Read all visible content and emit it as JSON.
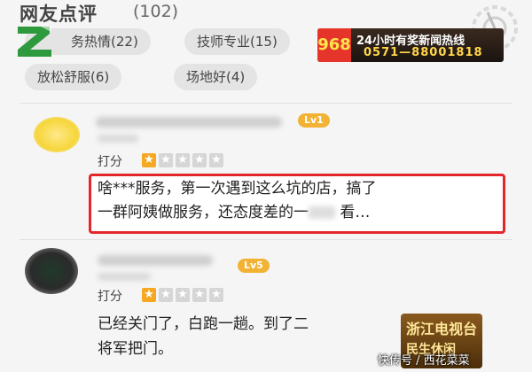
{
  "header": {
    "title": "网友点评",
    "count": "(102)"
  },
  "tags": [
    {
      "label": "务热情(22)"
    },
    {
      "label": "技师专业(15)"
    },
    {
      "label": "放松舒服(6)"
    },
    {
      "label": "场地好(4)"
    }
  ],
  "reviews": [
    {
      "level": "Lv1",
      "score_label": "打分",
      "rating": 1,
      "max_rating": 5,
      "text_line1": "啥***服务，第一次遇到这么坑的店，搞了",
      "text_line2_a": "一群阿姨做服务，还态度差的一",
      "text_line2_b": " 看…"
    },
    {
      "level": "Lv5",
      "score_label": "打分",
      "rating": 1,
      "max_rating": 5,
      "text_line1": "已经关门了，白跑一趟。到了二",
      "text_line2": "将军把门。"
    }
  ],
  "overlays": {
    "hotline_number": "968",
    "hotline_title": "24小时有奖新闻热线",
    "hotline_phone": "0571—88001818",
    "station_line1": "浙江电视台",
    "station_line2": "民生休闲",
    "watermark": "快传号 / 西花菜菜"
  },
  "colors": {
    "star_on": "#f7a823",
    "star_off": "#d6d6d6",
    "highlight_border": "#e4262a",
    "level_badge": "#f2b233"
  }
}
